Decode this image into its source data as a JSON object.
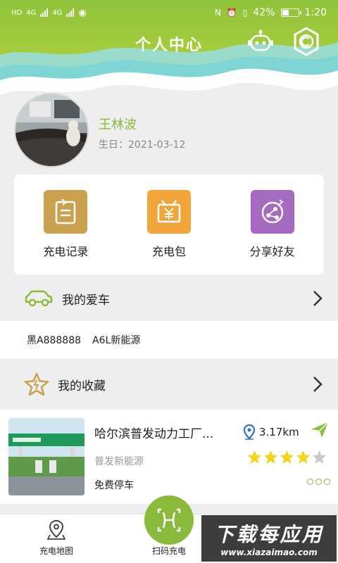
{
  "status_bar": {
    "left_labels": [
      "HD",
      "4G",
      "4G"
    ],
    "battery": "42%",
    "battery_level": 0.42,
    "time": "1:20"
  },
  "header": {
    "title": "个人中心",
    "icons": [
      "robot-icon",
      "settings-icon"
    ]
  },
  "profile": {
    "name": "王林波",
    "birthday_label": "生日：",
    "birthday": "2021-03-12"
  },
  "features": [
    {
      "label": "充电记录",
      "icon": "record-icon",
      "color": "#c9a14f"
    },
    {
      "label": "充电包",
      "icon": "package-icon",
      "color": "#f0a43a"
    },
    {
      "label": "分享好友",
      "icon": "share-icon",
      "color": "#a46bc1"
    }
  ],
  "my_car": {
    "label": "我的爱车",
    "plate": "黑A888888",
    "model": "A6L新能源"
  },
  "favorites": {
    "label": "我的收藏"
  },
  "station": {
    "name": "哈尔滨普发动力工厂...",
    "distance": "3.17km",
    "type": "普发新能源",
    "parking": "免费停车",
    "rating": 4,
    "rating_max": 5
  },
  "tabbar": {
    "map_label": "充电地图",
    "scan_label": "扫码充电"
  },
  "watermark": {
    "big": "下载每应用",
    "small": "www.xiazaimao.com"
  },
  "colors": {
    "accent": "#8aba3b",
    "teal": "#6fd3d8",
    "nav": "#86c040"
  }
}
